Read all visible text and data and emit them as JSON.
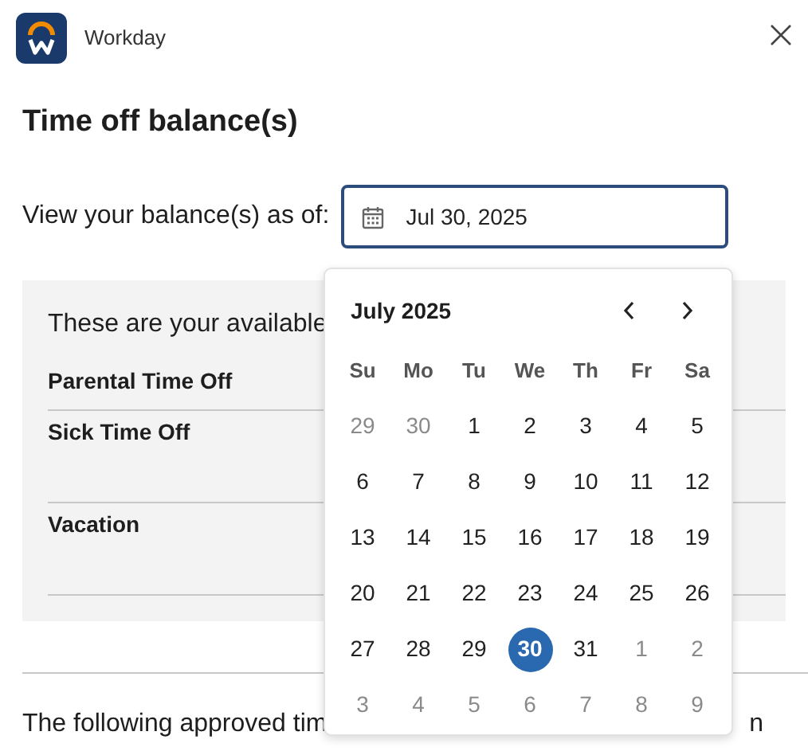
{
  "app": {
    "name": "Workday"
  },
  "page_title": "Time off balance(s)",
  "as_of": {
    "label": "View your balance(s) as of:",
    "value": "Jul 30, 2025"
  },
  "balances": {
    "intro": "These are your available",
    "rows": [
      {
        "name": "Parental Time Off"
      },
      {
        "name": "Sick Time Off"
      },
      {
        "name": "Vacation"
      }
    ]
  },
  "footer_text": [
    {
      "text": "The following approved tim"
    },
    {
      "text": "n"
    }
  ],
  "calendar": {
    "title": "July 2025",
    "weekdays": [
      "Su",
      "Mo",
      "Tu",
      "We",
      "Th",
      "Fr",
      "Sa"
    ],
    "weeks": [
      [
        {
          "label": "29",
          "outside": true,
          "selected": false
        },
        {
          "label": "30",
          "outside": true,
          "selected": false
        },
        {
          "label": "1",
          "outside": false,
          "selected": false
        },
        {
          "label": "2",
          "outside": false,
          "selected": false
        },
        {
          "label": "3",
          "outside": false,
          "selected": false
        },
        {
          "label": "4",
          "outside": false,
          "selected": false
        },
        {
          "label": "5",
          "outside": false,
          "selected": false
        }
      ],
      [
        {
          "label": "6",
          "outside": false,
          "selected": false
        },
        {
          "label": "7",
          "outside": false,
          "selected": false
        },
        {
          "label": "8",
          "outside": false,
          "selected": false
        },
        {
          "label": "9",
          "outside": false,
          "selected": false
        },
        {
          "label": "10",
          "outside": false,
          "selected": false
        },
        {
          "label": "11",
          "outside": false,
          "selected": false
        },
        {
          "label": "12",
          "outside": false,
          "selected": false
        }
      ],
      [
        {
          "label": "13",
          "outside": false,
          "selected": false
        },
        {
          "label": "14",
          "outside": false,
          "selected": false
        },
        {
          "label": "15",
          "outside": false,
          "selected": false
        },
        {
          "label": "16",
          "outside": false,
          "selected": false
        },
        {
          "label": "17",
          "outside": false,
          "selected": false
        },
        {
          "label": "18",
          "outside": false,
          "selected": false
        },
        {
          "label": "19",
          "outside": false,
          "selected": false
        }
      ],
      [
        {
          "label": "20",
          "outside": false,
          "selected": false
        },
        {
          "label": "21",
          "outside": false,
          "selected": false
        },
        {
          "label": "22",
          "outside": false,
          "selected": false
        },
        {
          "label": "23",
          "outside": false,
          "selected": false
        },
        {
          "label": "24",
          "outside": false,
          "selected": false
        },
        {
          "label": "25",
          "outside": false,
          "selected": false
        },
        {
          "label": "26",
          "outside": false,
          "selected": false
        }
      ],
      [
        {
          "label": "27",
          "outside": false,
          "selected": false
        },
        {
          "label": "28",
          "outside": false,
          "selected": false
        },
        {
          "label": "29",
          "outside": false,
          "selected": false
        },
        {
          "label": "30",
          "outside": false,
          "selected": true
        },
        {
          "label": "31",
          "outside": false,
          "selected": false
        },
        {
          "label": "1",
          "outside": true,
          "selected": false
        },
        {
          "label": "2",
          "outside": true,
          "selected": false
        }
      ],
      [
        {
          "label": "3",
          "outside": true,
          "selected": false
        },
        {
          "label": "4",
          "outside": true,
          "selected": false
        },
        {
          "label": "5",
          "outside": true,
          "selected": false
        },
        {
          "label": "6",
          "outside": true,
          "selected": false
        },
        {
          "label": "7",
          "outside": true,
          "selected": false
        },
        {
          "label": "8",
          "outside": true,
          "selected": false
        },
        {
          "label": "9",
          "outside": true,
          "selected": false
        }
      ]
    ]
  }
}
